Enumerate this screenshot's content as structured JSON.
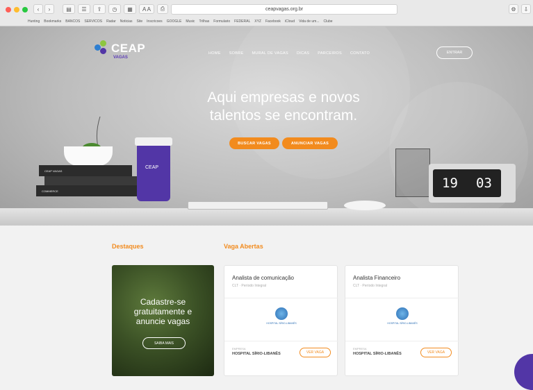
{
  "browser": {
    "url": "ceapvagas.org.br",
    "bookmarks": [
      "Hunting",
      "Bookmarks",
      "BANCOS",
      "SERVICOS",
      "Radar",
      "Noticias",
      "Site",
      "Inscricoes",
      "GOOGLE",
      "Music",
      "Trilhas",
      "Formulario",
      "FEDERAL",
      "XYZ",
      "Facebook",
      "iCloud",
      "Vida de um...",
      "Clube"
    ]
  },
  "nav": {
    "logo_name": "CEAP",
    "logo_sub": "VAGAS",
    "items": [
      "HOME",
      "SOBRE",
      "MURAL DE VAGAS",
      "DICAS",
      "PARCEIROS",
      "CONTATO"
    ],
    "login": "ENTRAR"
  },
  "hero": {
    "headline_1": "Aqui empresas e novos",
    "headline_2": "talentos se encontram.",
    "buscar": "BUSCAR VAGAS",
    "anunciar": "ANUNCIAR VAGAS",
    "clock_h": "19",
    "clock_m": "03",
    "cup_logo": "CEAP",
    "book1": "CEAP VAGAS",
    "book2": "COMMERCE"
  },
  "sections": {
    "destaques": "Destaques",
    "abertas": "Vaga Abertas"
  },
  "promo": {
    "line1": "Cadastre-se",
    "line2": "gratuitamente e",
    "line3": "anuncie vagas",
    "button": "SAIBA MAIS"
  },
  "jobs": [
    {
      "title": "Analista de comunicação",
      "meta": "CLT · Período Integral",
      "company_key": "EMPRESA",
      "company": "HOSPITAL SÍRIO-LIBANÊS",
      "logo_label": "HOSPITAL SÍRIO-LIBANÊS",
      "view": "VER VAGA"
    },
    {
      "title": "Analista Financeiro",
      "meta": "CLT · Período Integral",
      "company_key": "EMPRESA",
      "company": "HOSPITAL SÍRIO-LIBANÊS",
      "logo_label": "HOSPITAL SÍRIO-LIBANÊS",
      "view": "VER VAGA"
    }
  ],
  "colors": {
    "accent": "#f28b1e",
    "brand": "#5236a6"
  }
}
